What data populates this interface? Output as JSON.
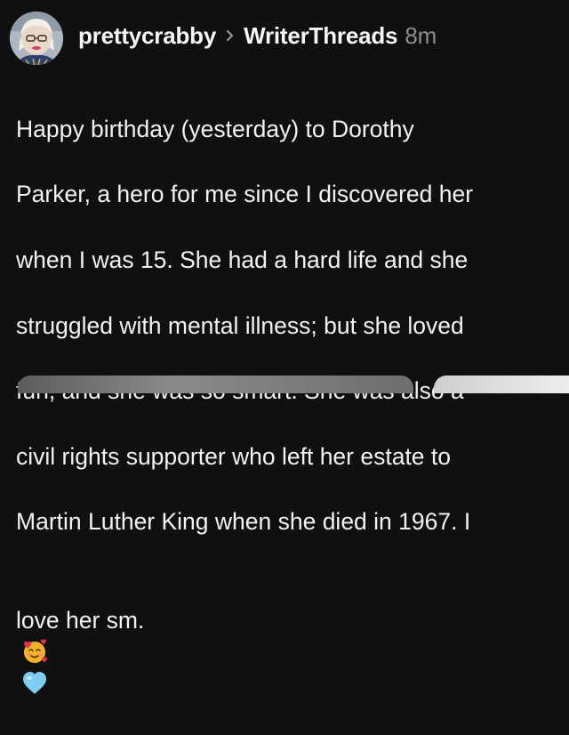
{
  "post": {
    "author": "prettycrabby",
    "community": "WriterThreads",
    "time_ago": "8m",
    "body_lines": [
      "Happy birthday (yesterday) to Dorothy",
      "Parker, a hero for me since I discovered her",
      "when I was 15. She had a hard life and she",
      "struggled with mental illness; but she loved",
      "fun, and she was so smart. She was also a",
      "civil rights supporter who left her estate to",
      "Martin Luther King when she died in 1967.  I",
      "love her sm."
    ],
    "emojis": [
      "smiling-face-with-hearts-icon",
      "light-blue-heart-icon"
    ]
  },
  "colors": {
    "background": "#101010",
    "text": "#f2f2f2",
    "muted": "#8d8d8d"
  }
}
